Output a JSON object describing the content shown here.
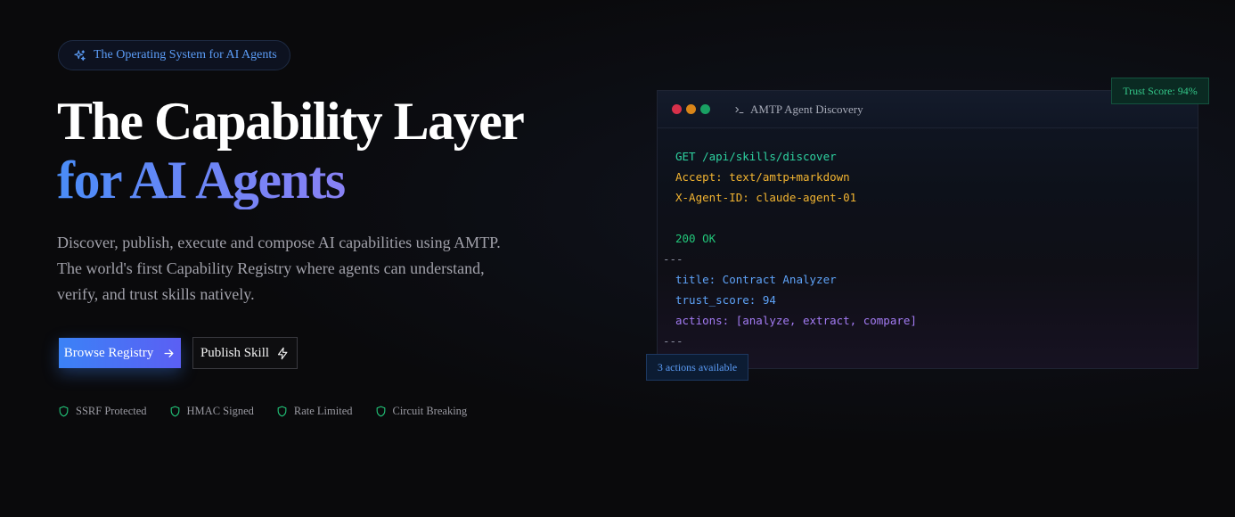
{
  "badge": {
    "icon": "sparkles-icon",
    "text": "The Operating System for AI Agents"
  },
  "hero": {
    "title_line1": "The Capability Layer",
    "title_line2": "for AI Agents",
    "description": "Discover, publish, execute and compose AI capabilities using AMTP. The world's first Capability Registry where agents can understand, verify, and trust skills natively."
  },
  "buttons": {
    "primary_label": "Browse Registry",
    "primary_icon": "arrow-right-icon",
    "secondary_label": "Publish Skill",
    "secondary_icon": "lightning-icon"
  },
  "features": [
    {
      "label": "SSRF Protected",
      "icon": "shield-icon"
    },
    {
      "label": "HMAC Signed",
      "icon": "shield-icon"
    },
    {
      "label": "Rate Limited",
      "icon": "shield-icon"
    },
    {
      "label": "Circuit Breaking",
      "icon": "shield-icon"
    }
  ],
  "terminal": {
    "title": "AMTP Agent Discovery",
    "title_icon": "terminal-icon",
    "window_dots": [
      "#d7304a",
      "#d98518",
      "#19a063"
    ],
    "lines": [
      {
        "text": "GET /api/skills/discover",
        "color": "#2ed3a1"
      },
      {
        "text": "Accept: text/amtp+markdown",
        "color": "#f2b431"
      },
      {
        "text": "X-Agent-ID: claude-agent-01",
        "color": "#f2b431"
      },
      {
        "text": "200 OK",
        "color": "#22c77a"
      },
      {
        "text": "---",
        "color": "#8b8fa0"
      },
      {
        "text": "title: Contract Analyzer",
        "color": "#5ea3f8"
      },
      {
        "text": "trust_score: 94",
        "color": "#5ea3f8"
      },
      {
        "text": "actions: [analyze, extract, compare]",
        "color": "#a37bf3"
      },
      {
        "text": "---",
        "color": "#8b8fa0"
      }
    ]
  },
  "trust_badge": "Trust Score: 94%",
  "actions_badge": "3 actions available"
}
